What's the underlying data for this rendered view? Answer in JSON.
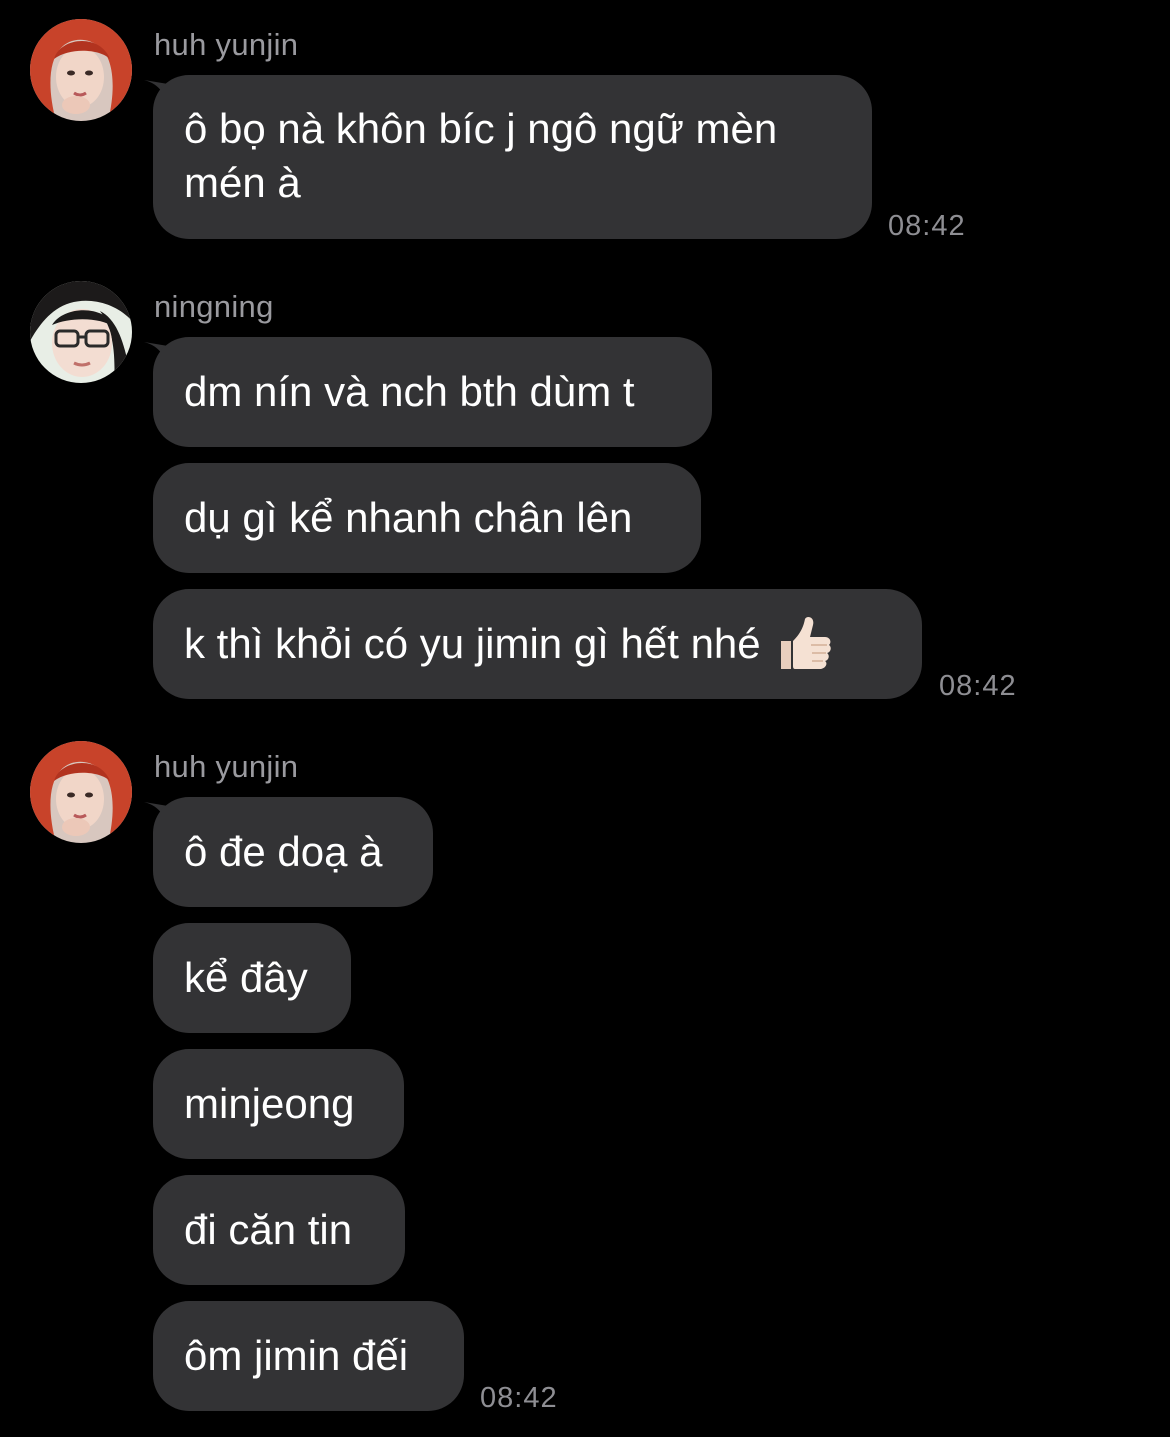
{
  "groups": [
    {
      "sender": "huh yunjin",
      "avatar_icon": "avatar-red-hair-icon",
      "messages": [
        {
          "text": "ô bọ nà khôn bíc j ngô ngữ mèn mén à"
        }
      ],
      "time": "08:42"
    },
    {
      "sender": "ningning",
      "avatar_icon": "avatar-glasses-icon",
      "messages": [
        {
          "text": "dm nín và nch bth dùm t"
        },
        {
          "text": "dụ gì kể nhanh chân lên"
        },
        {
          "text": "k thì khỏi có yu jimin gì hết nhé",
          "emoji": "thumbs-up-icon"
        }
      ],
      "time": "08:42"
    },
    {
      "sender": "huh yunjin",
      "avatar_icon": "avatar-red-hair-icon",
      "messages": [
        {
          "text": "ô đe doạ à"
        },
        {
          "text": "kể đây"
        },
        {
          "text": "minjeong"
        },
        {
          "text": "đi căn tin"
        },
        {
          "text": "ôm jimin đếi"
        }
      ],
      "time": "08:42"
    }
  ],
  "colors": {
    "background": "#000000",
    "bubble": "#333335",
    "sender_name": "#9a9a9f",
    "timestamp": "#8e8e93"
  }
}
